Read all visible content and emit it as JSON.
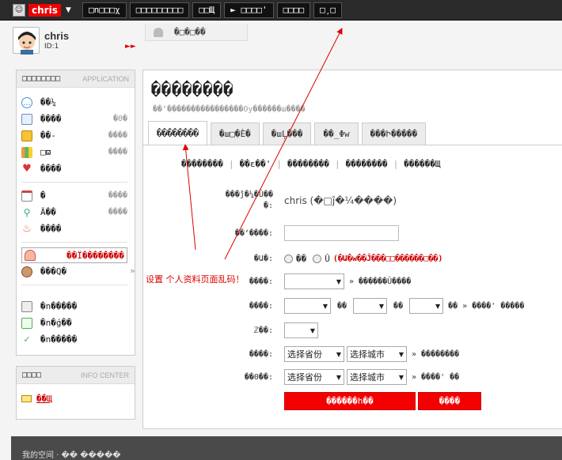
{
  "topbar": {
    "user": "chris",
    "nav": [
      "□n□□□χ",
      "□□□□□□□□□",
      "□□Щ",
      "► □□□□'",
      "□□□□",
      "□¸□"
    ]
  },
  "profile": {
    "name": "chris",
    "id": "ID:1",
    "status": "�□�□��"
  },
  "apps": {
    "title": "□□□□□□□□",
    "title_en": "APPLICATION",
    "items": [
      {
        "label": "��¼",
        "extra": ""
      },
      {
        "label": "����",
        "extra": "�Θ�"
      },
      {
        "label": "��-",
        "extra": "����"
      },
      {
        "label": "□ϖ",
        "extra": "����"
      },
      {
        "label": "����",
        "extra": ""
      },
      {
        "label": "�",
        "extra": "����"
      },
      {
        "label": "Ä��",
        "extra": "����"
      },
      {
        "label": "����",
        "extra": ""
      },
      {
        "label": "��Ϊ��������",
        "extra": ""
      },
      {
        "label": "���Q�",
        "extra": ""
      },
      {
        "label": "�n�����",
        "extra": ""
      },
      {
        "label": "�n�ǵ��",
        "extra": ""
      },
      {
        "label": "�n�����",
        "extra": ""
      }
    ]
  },
  "info_center": {
    "title": "□□□□",
    "title_en": "INFO CENTER",
    "link": "��Щ"
  },
  "main": {
    "title": "��������",
    "subtitle": "��ʻ����������������Oy������ш����",
    "tabs": [
      "��������",
      "�ш□�Ѐ�",
      "�шĻ���",
      "��_Φw",
      "���Ի�����"
    ],
    "subnav": [
      "��������",
      "��ɛ��'",
      "��������",
      "��������",
      "������Щ"
    ],
    "form": {
      "realname_label": "���ĵ�¼�Û��",
      "realname_colon": "�:",
      "realname_value": "chris (�□ĵ�¼����)",
      "nick_label": "��ʻ����:",
      "gender_label": "�Ա�:",
      "gender_opt1": "��",
      "gender_opt2": "Û",
      "gender_note": "(�Ա�w��Ĵ���□□������□��)",
      "blood_label": "����:",
      "blood_hint": "» ������Û����",
      "birth_label": "����:",
      "birth_sep1": "��",
      "birth_sep2": "��",
      "birth_hint": "�� » ����' �����",
      "zodiac_label": "ℤ��:",
      "home_label": "����:",
      "home_province": "选择省份",
      "home_city": "选择城市",
      "home_hint": "» ��������",
      "reside_label": "��0��:",
      "reside_province": "选择省份",
      "reside_city": "选择城市",
      "reside_hint": "» ����' ��",
      "save_label": "������h��",
      "cancel_label": "����"
    }
  },
  "annotation": "设置 个人资料页面乱码！",
  "footer": "我的空间 · �� �����",
  "colors": {
    "accent": "#f40000",
    "topbar": "#2a2a2a",
    "annotation": "#d00000"
  }
}
